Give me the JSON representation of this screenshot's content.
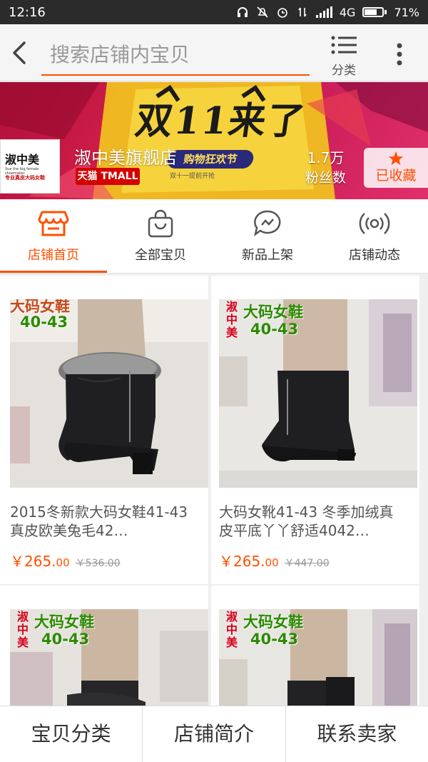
{
  "status_bar": {
    "time": "12:16",
    "network": "4G",
    "battery": "71%"
  },
  "header": {
    "search_placeholder": "搜索店铺内宝贝",
    "category_label": "分类"
  },
  "banner": {
    "headline": "双11来了",
    "festival": "购物狂欢节",
    "festival_date": "双十一提前开抢",
    "shop_logo_main": "淑中美",
    "shop_logo_sub": "Sue the big female shoemaker",
    "shop_logo_tag": "专业真皮大码女鞋",
    "shop_name": "淑中美旗舰店",
    "tmall_badge": "天猫 TMALL",
    "fans_count": "1.7万",
    "fans_label": "粉丝数",
    "favorite_label": "已收藏"
  },
  "tabs": [
    {
      "label": "店铺首页",
      "icon": "shop-icon",
      "active": true
    },
    {
      "label": "全部宝贝",
      "icon": "bag-icon",
      "active": false
    },
    {
      "label": "新品上架",
      "icon": "new-arrivals-icon",
      "active": false
    },
    {
      "label": "店铺动态",
      "icon": "broadcast-icon",
      "active": false
    }
  ],
  "products": [
    {
      "tag_side": "",
      "tag_line1": "大码女鞋",
      "tag_line2": "40-43",
      "title": "2015冬新款大码女鞋41-43真皮欧美兔毛42…",
      "price_int": "￥265.",
      "price_dec": "00",
      "original_price": "￥536.00"
    },
    {
      "tag_side": "淑中美",
      "tag_line1": "大码女鞋",
      "tag_line2": "40-43",
      "title": "大码女靴41-43 冬季加绒真皮平底丫丫舒适4042…",
      "price_int": "￥265.",
      "price_dec": "00",
      "original_price": "￥447.00"
    },
    {
      "tag_side": "淑中美",
      "tag_line1": "大码女鞋",
      "tag_line2": "40-43",
      "title": "",
      "price_int": "",
      "price_dec": "",
      "original_price": ""
    },
    {
      "tag_side": "淑中美",
      "tag_line1": "大码女鞋",
      "tag_line2": "40-43",
      "title": "",
      "price_int": "",
      "price_dec": "",
      "original_price": ""
    }
  ],
  "bottom_bar": {
    "categories": "宝贝分类",
    "shop_intro": "店铺简介",
    "contact": "联系卖家"
  },
  "colors": {
    "accent": "#ff5000",
    "tag_green": "#2b8a00",
    "tag_red": "#d6001c"
  }
}
